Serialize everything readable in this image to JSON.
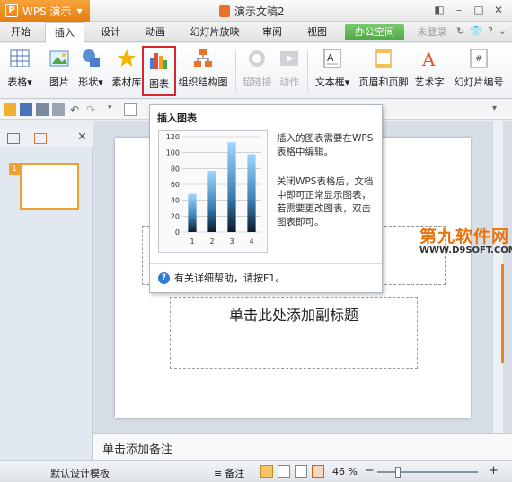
{
  "titlebar": {
    "app_name": "WPS 演示",
    "doc_title": "演示文稿2"
  },
  "menu": {
    "tabs": [
      "开始",
      "插入",
      "设计",
      "动画",
      "幻灯片放映",
      "审阅",
      "视图"
    ],
    "active": "插入",
    "office_space": "办公空间",
    "login": "未登录"
  },
  "ribbon": {
    "table": "表格",
    "picture": "图片",
    "shape": "形状",
    "material": "素材库",
    "chart": "图表",
    "orgchart": "组织结构图",
    "hyperlink": "超链接",
    "action": "动作",
    "textbox": "文本框",
    "header_footer": "页眉和页脚",
    "wordart": "艺术字",
    "slide_number": "幻灯片编号"
  },
  "tooltip": {
    "title": "插入图表",
    "desc1": "插入的图表需要在WPS表格中编辑。",
    "desc2": "关闭WPS表格后，文档中即可正常显示图表，若需要更改图表，双击图表即可。",
    "help": "有关详细帮助，请按F1。"
  },
  "chart_data": {
    "type": "bar",
    "categories": [
      "1",
      "2",
      "3",
      "4"
    ],
    "values": [
      48,
      77,
      113,
      98
    ],
    "ylim": [
      0,
      120
    ],
    "yticks": [
      "120",
      "100",
      "80",
      "60",
      "40",
      "20",
      "0"
    ],
    "grid": true
  },
  "slide": {
    "thumb_number": "1",
    "subtitle_placeholder": "单击此处添加副标题"
  },
  "notes": {
    "placeholder": "单击添加备注"
  },
  "statusbar": {
    "template": "默认设计模板",
    "notes_label": "备注",
    "zoom": "46 %",
    "zoom_minus": "−",
    "zoom_plus": "+"
  },
  "watermark": {
    "cn": "第九软件网",
    "en": "WWW.D9SOFT.COM"
  }
}
